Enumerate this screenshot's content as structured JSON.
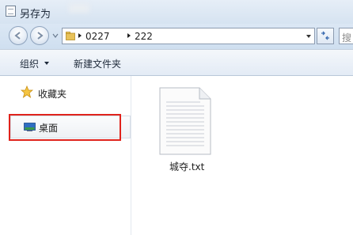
{
  "window": {
    "title": "另存为"
  },
  "address": {
    "crumbs": [
      "0227",
      "222"
    ]
  },
  "toolbar": {
    "organize_label": "组织",
    "new_folder_label": "新建文件夹"
  },
  "nav_pane": {
    "favorites_label": "收藏夹",
    "desktop_label": "桌面"
  },
  "files": [
    {
      "name": "城夺.txt",
      "icon": "text-file-icon"
    }
  ],
  "colors": {
    "highlight": "#e0231c",
    "titlebar": "#dbe7f4"
  }
}
